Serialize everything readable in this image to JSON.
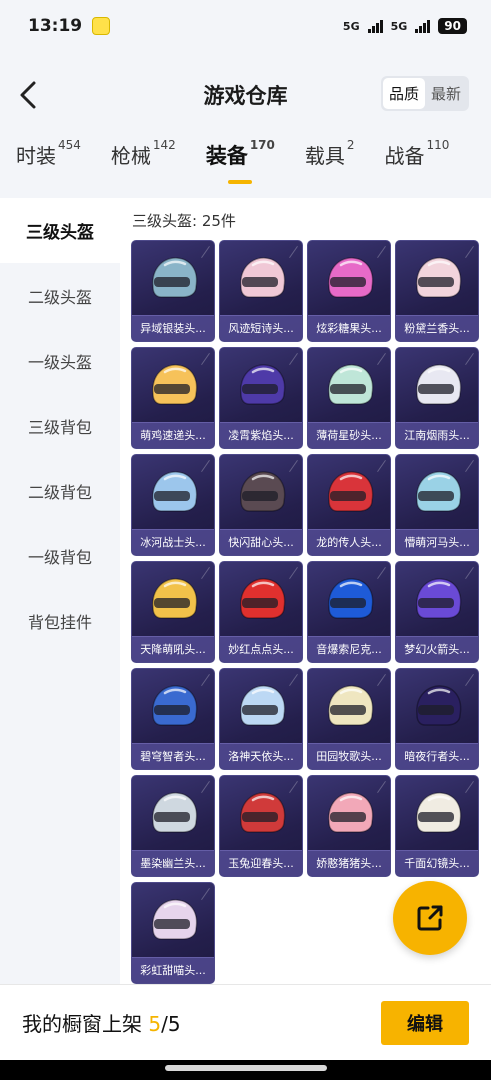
{
  "status_bar": {
    "time": "13:19",
    "network1": "5G",
    "network2": "5G",
    "battery": "90"
  },
  "header": {
    "title": "游戏仓库",
    "back_icon": "chevron-left-icon",
    "sort_options": [
      "品质",
      "最新"
    ],
    "sort_active": "品质"
  },
  "categories": [
    {
      "label": "时装",
      "count": "454"
    },
    {
      "label": "枪械",
      "count": "142"
    },
    {
      "label": "装备",
      "count": "170",
      "active": true
    },
    {
      "label": "载具",
      "count": "2"
    },
    {
      "label": "战备",
      "count": "110"
    }
  ],
  "sidebar": {
    "items": [
      {
        "label": "三级头盔",
        "active": true
      },
      {
        "label": "二级头盔"
      },
      {
        "label": "一级头盔"
      },
      {
        "label": "三级背包"
      },
      {
        "label": "二级背包"
      },
      {
        "label": "一级背包"
      },
      {
        "label": "背包挂件"
      }
    ]
  },
  "main": {
    "subheading": "三级头盔: 25件",
    "items": [
      {
        "name": "异域银装头...",
        "color": "#8ab4c8"
      },
      {
        "name": "风迹短诗头...",
        "color": "#f0c8d6"
      },
      {
        "name": "炫彩糖果头...",
        "color": "#e76ac8"
      },
      {
        "name": "粉黛兰香头...",
        "color": "#f2d4dc"
      },
      {
        "name": "萌鸡速递头...",
        "color": "#f6c25a"
      },
      {
        "name": "凌霄紫焰头...",
        "color": "#4e3aa8"
      },
      {
        "name": "薄荷星砂头...",
        "color": "#bfe6d8"
      },
      {
        "name": "江南烟雨头...",
        "color": "#e8e8f2"
      },
      {
        "name": "冰河战士头...",
        "color": "#9cc6ec"
      },
      {
        "name": "快闪甜心头...",
        "color": "#5a4a52"
      },
      {
        "name": "龙的传人头...",
        "color": "#d9343a"
      },
      {
        "name": "懵萌河马头...",
        "color": "#9ad2e6"
      },
      {
        "name": "天降萌吼头...",
        "color": "#f2c24a"
      },
      {
        "name": "妙红点点头...",
        "color": "#e0302e"
      },
      {
        "name": "音爆索尼克...",
        "color": "#1e5bd8"
      },
      {
        "name": "梦幻火箭头...",
        "color": "#6a4ad6"
      },
      {
        "name": "碧穹智者头...",
        "color": "#3a6ad0"
      },
      {
        "name": "洛神天依头...",
        "color": "#bcd8f4"
      },
      {
        "name": "田园牧歌头...",
        "color": "#efe6c0"
      },
      {
        "name": "暗夜行者头...",
        "color": "#2a2060"
      },
      {
        "name": "墨染幽兰头...",
        "color": "#cfd8e0"
      },
      {
        "name": "玉兔迎春头...",
        "color": "#d03a3a"
      },
      {
        "name": "娇憨猪猪头...",
        "color": "#f2a8b8"
      },
      {
        "name": "千面幻镜头...",
        "color": "#f0ece2"
      },
      {
        "name": "彩虹甜喵头...",
        "color": "#e6d4ec"
      }
    ]
  },
  "fab": {
    "icon": "share-out-icon"
  },
  "bottom_bar": {
    "label": "我的橱窗上架 ",
    "current": "5",
    "total": "/5",
    "edit_label": "编辑"
  },
  "colors": {
    "accent": "#f7b300",
    "card_bg": "#2a2558"
  }
}
